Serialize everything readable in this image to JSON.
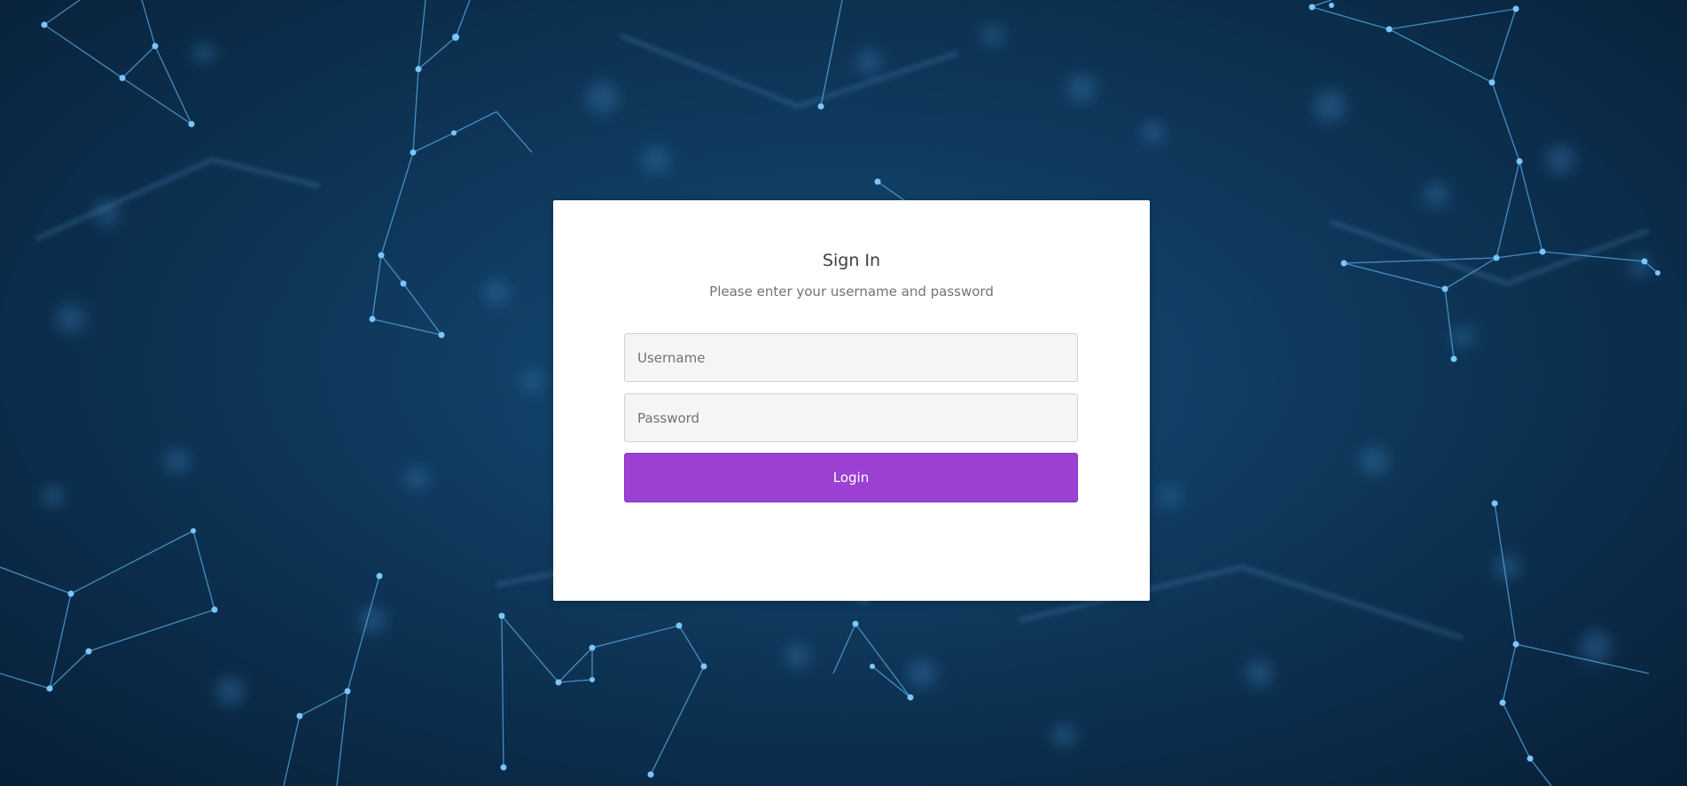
{
  "background": {
    "theme": "blue network plexus",
    "base_color": "#0f3a5e",
    "node_color": "#5fb4f0"
  },
  "login": {
    "title": "Sign In",
    "subtitle": "Please enter your username and password",
    "username_placeholder": "Username",
    "username_value": "",
    "password_placeholder": "Password",
    "password_value": "",
    "login_label": "Login",
    "button_color": "#9b40d2"
  }
}
